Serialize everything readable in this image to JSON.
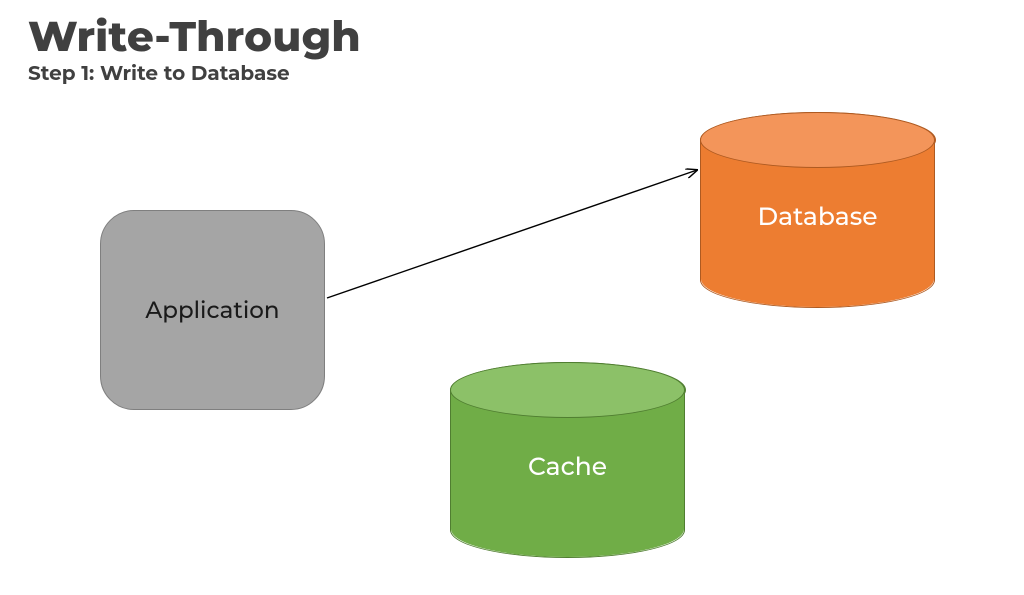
{
  "title": "Write-Through",
  "subtitle": "Step 1: Write to Database",
  "nodes": {
    "application": {
      "label": "Application",
      "shape": "rounded-rect",
      "fill": "#a5a5a5",
      "border": "#7f7f7f"
    },
    "database": {
      "label": "Database",
      "shape": "cylinder",
      "fill": "#ed7d31",
      "lid": "#f3955a",
      "border": "#ae5a21"
    },
    "cache": {
      "label": "Cache",
      "shape": "cylinder",
      "fill": "#70ad47",
      "lid": "#8cc168",
      "border": "#507e31"
    }
  },
  "arrows": [
    {
      "from": "application",
      "to": "database",
      "style": "solid",
      "color": "#000000"
    }
  ]
}
